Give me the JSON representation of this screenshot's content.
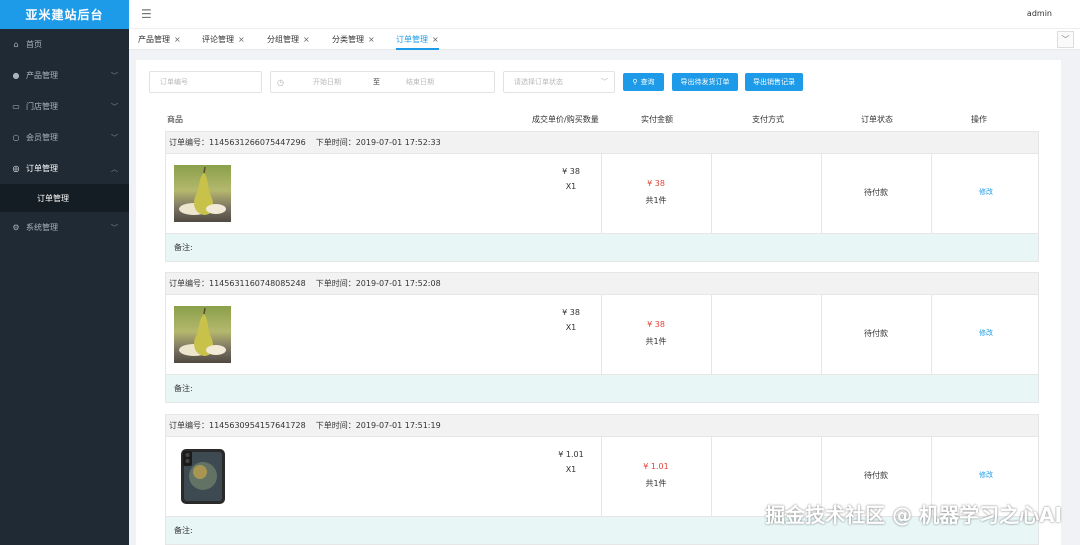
{
  "brand": "亚米建站后台",
  "header": {
    "user": "admin"
  },
  "sidebar": {
    "items": [
      {
        "label": "首页",
        "icon": "home-icon",
        "glyph": "⌂",
        "expandable": false
      },
      {
        "label": "产品管理",
        "icon": "user-icon",
        "glyph": "●",
        "expandable": true
      },
      {
        "label": "门店管理",
        "icon": "store-icon",
        "glyph": "▭",
        "expandable": true
      },
      {
        "label": "会员管理",
        "icon": "member-icon",
        "glyph": "○",
        "expandable": true
      },
      {
        "label": "订单管理",
        "icon": "order-icon",
        "glyph": "◎",
        "expandable": true,
        "active": true
      },
      {
        "label": "系统管理",
        "icon": "settings-icon",
        "glyph": "⚙",
        "expandable": true
      }
    ],
    "submenu": {
      "label": "订单管理"
    }
  },
  "tabs": [
    {
      "label": "产品管理",
      "close": "×"
    },
    {
      "label": "评论管理",
      "close": "×"
    },
    {
      "label": "分组管理",
      "close": "×"
    },
    {
      "label": "分类管理",
      "close": "×"
    },
    {
      "label": "订单管理",
      "close": "×",
      "active": true
    }
  ],
  "filters": {
    "order_no_placeholder": "订单编号",
    "start_date_placeholder": "开始日期",
    "date_separator": "至",
    "end_date_placeholder": "结束日期",
    "status_placeholder": "请选择订单状态",
    "search_label": "查询",
    "export_pending_label": "导出待发货订单",
    "export_sales_label": "导出销售记录"
  },
  "table": {
    "headers": [
      "商品",
      "成交单价/购买数量",
      "实付金额",
      "支付方式",
      "订单状态",
      "操作"
    ]
  },
  "orders": [
    {
      "order_label": "订单编号：1145631266075447296",
      "time_label": "下单时间：2019-07-01 17:52:33",
      "image": "pear",
      "unit_price": "¥ 38",
      "quantity": "X1",
      "paid": "¥ 38",
      "count": "共1件",
      "pay_method": "",
      "status": "待付款",
      "action": "修改",
      "note": "备注:"
    },
    {
      "order_label": "订单编号：1145631160748085248",
      "time_label": "下单时间：2019-07-01 17:52:08",
      "image": "pear",
      "unit_price": "¥ 38",
      "quantity": "X1",
      "paid": "¥ 38",
      "count": "共1件",
      "pay_method": "",
      "status": "待付款",
      "action": "修改",
      "note": "备注:"
    },
    {
      "order_label": "订单编号：1145630954157641728",
      "time_label": "下单时间：2019-07-01 17:51:19",
      "image": "phone",
      "unit_price": "¥ 1.01",
      "quantity": "X1",
      "paid": "¥ 1.01",
      "count": "共1件",
      "pay_method": "",
      "status": "待付款",
      "action": "修改",
      "note": "备注:"
    }
  ],
  "watermark": "掘金技术社区 @ 机器学习之心AI",
  "colors": {
    "accent": "#1e9be8",
    "sidebar": "#1f2a34",
    "price": "#e0453a",
    "note_bg": "#e8f6f6"
  }
}
